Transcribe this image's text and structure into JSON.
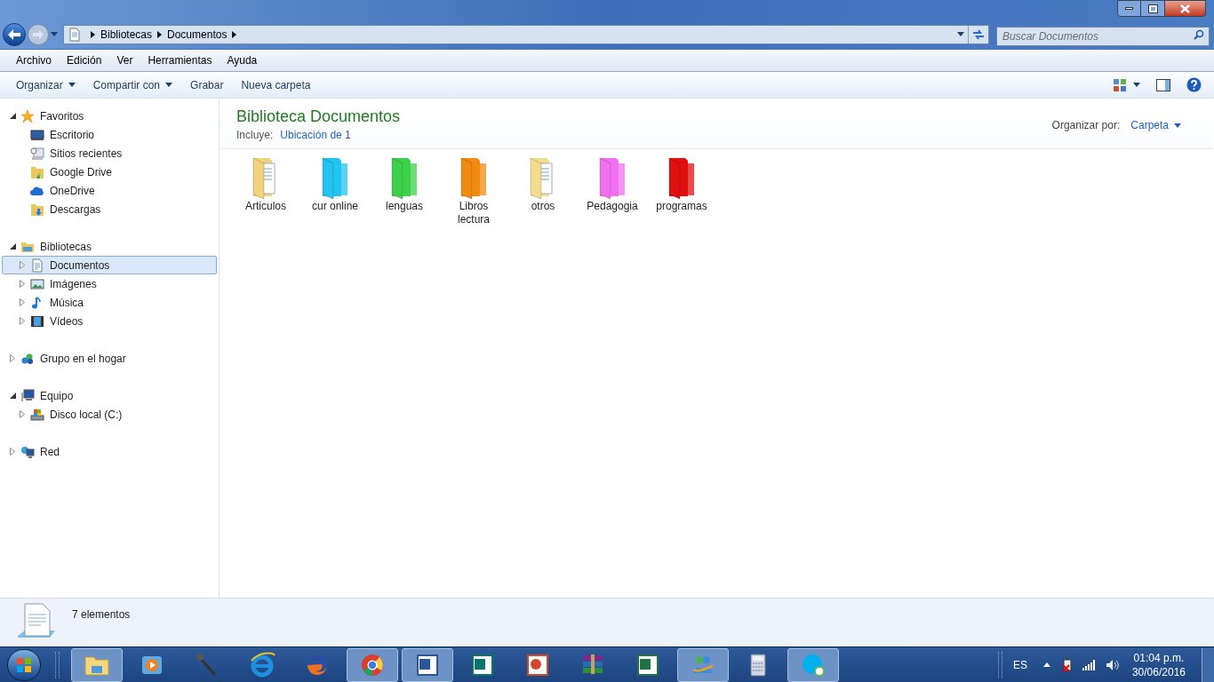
{
  "address": {
    "path": [
      "Bibliotecas",
      "Documentos"
    ]
  },
  "search": {
    "placeholder": "Buscar Documentos"
  },
  "menu": [
    "Archivo",
    "Edición",
    "Ver",
    "Herramientas",
    "Ayuda"
  ],
  "toolbar": [
    {
      "label": "Organizar",
      "dropdown": true
    },
    {
      "label": "Compartir con",
      "dropdown": true
    },
    {
      "label": "Grabar",
      "dropdown": false
    },
    {
      "label": "Nueva carpeta",
      "dropdown": false
    }
  ],
  "navigation": [
    {
      "label": "Favoritos",
      "kind": "star",
      "expanded": true,
      "selected": false,
      "children": [
        {
          "label": "Escritorio",
          "kind": "desktop",
          "selected": false
        },
        {
          "label": "Sitios recientes",
          "kind": "recent",
          "selected": false
        },
        {
          "label": "Google Drive",
          "kind": "gdrive",
          "selected": false
        },
        {
          "label": "OneDrive",
          "kind": "cloud",
          "selected": false
        },
        {
          "label": "Descargas",
          "kind": "download",
          "selected": false
        }
      ]
    },
    {
      "label": "Bibliotecas",
      "kind": "library",
      "expanded": true,
      "selected": false,
      "children": [
        {
          "label": "Documentos",
          "kind": "document",
          "expanded": false,
          "selected": true
        },
        {
          "label": "Imágenes",
          "kind": "picture",
          "expanded": false,
          "selected": false
        },
        {
          "label": "Música",
          "kind": "music",
          "expanded": false,
          "selected": false
        },
        {
          "label": "Vídeos",
          "kind": "video",
          "expanded": false,
          "selected": false
        }
      ]
    },
    {
      "label": "Grupo en el hogar",
      "kind": "homegroup",
      "expanded": false,
      "selected": false
    },
    {
      "label": "Equipo",
      "kind": "computer",
      "expanded": true,
      "selected": false,
      "children": [
        {
          "label": "Disco local (C:)",
          "kind": "drive",
          "expanded": false,
          "selected": false
        }
      ]
    },
    {
      "label": "Red",
      "kind": "network",
      "expanded": false,
      "selected": false
    }
  ],
  "content": {
    "title": "Biblioteca Documentos",
    "includes_label": "Incluye:",
    "includes_link": "Ubicación de 1",
    "arrange_label": "Organizar por:",
    "arrange_value": "Carpeta"
  },
  "folders": [
    {
      "name": "Articulos",
      "kind": "papers",
      "color": "#f0d37a"
    },
    {
      "name": "cur online",
      "kind": "plain",
      "color": "#22c3f0"
    },
    {
      "name": "lenguas",
      "kind": "plain",
      "color": "#3ed04a"
    },
    {
      "name": "Libros lectura",
      "kind": "plain",
      "color": "#f08a10"
    },
    {
      "name": "otros",
      "kind": "papers",
      "color": "#f3dc90"
    },
    {
      "name": "Pedagogia",
      "kind": "plain",
      "color": "#f070f0"
    },
    {
      "name": "programas",
      "kind": "plain",
      "color": "#e01010"
    }
  ],
  "status_bar": {
    "count": "7 elementos"
  },
  "taskbar": {
    "apps": [
      {
        "kind": "explorer",
        "active": true
      },
      {
        "kind": "media",
        "active": false
      },
      {
        "kind": "microphone",
        "active": false
      },
      {
        "kind": "ie",
        "active": false
      },
      {
        "kind": "firefox",
        "active": false
      },
      {
        "kind": "chrome",
        "active": true
      },
      {
        "kind": "word",
        "active": true
      },
      {
        "kind": "publisher",
        "active": false
      },
      {
        "kind": "powerpoint",
        "active": false
      },
      {
        "kind": "winrar",
        "active": false
      },
      {
        "kind": "excel",
        "active": false
      },
      {
        "kind": "messenger",
        "active": true
      },
      {
        "kind": "calculator",
        "active": false
      },
      {
        "kind": "skype",
        "active": true
      }
    ],
    "language": "ES",
    "time": "01:04 p.m.",
    "date": "30/06/2016"
  }
}
